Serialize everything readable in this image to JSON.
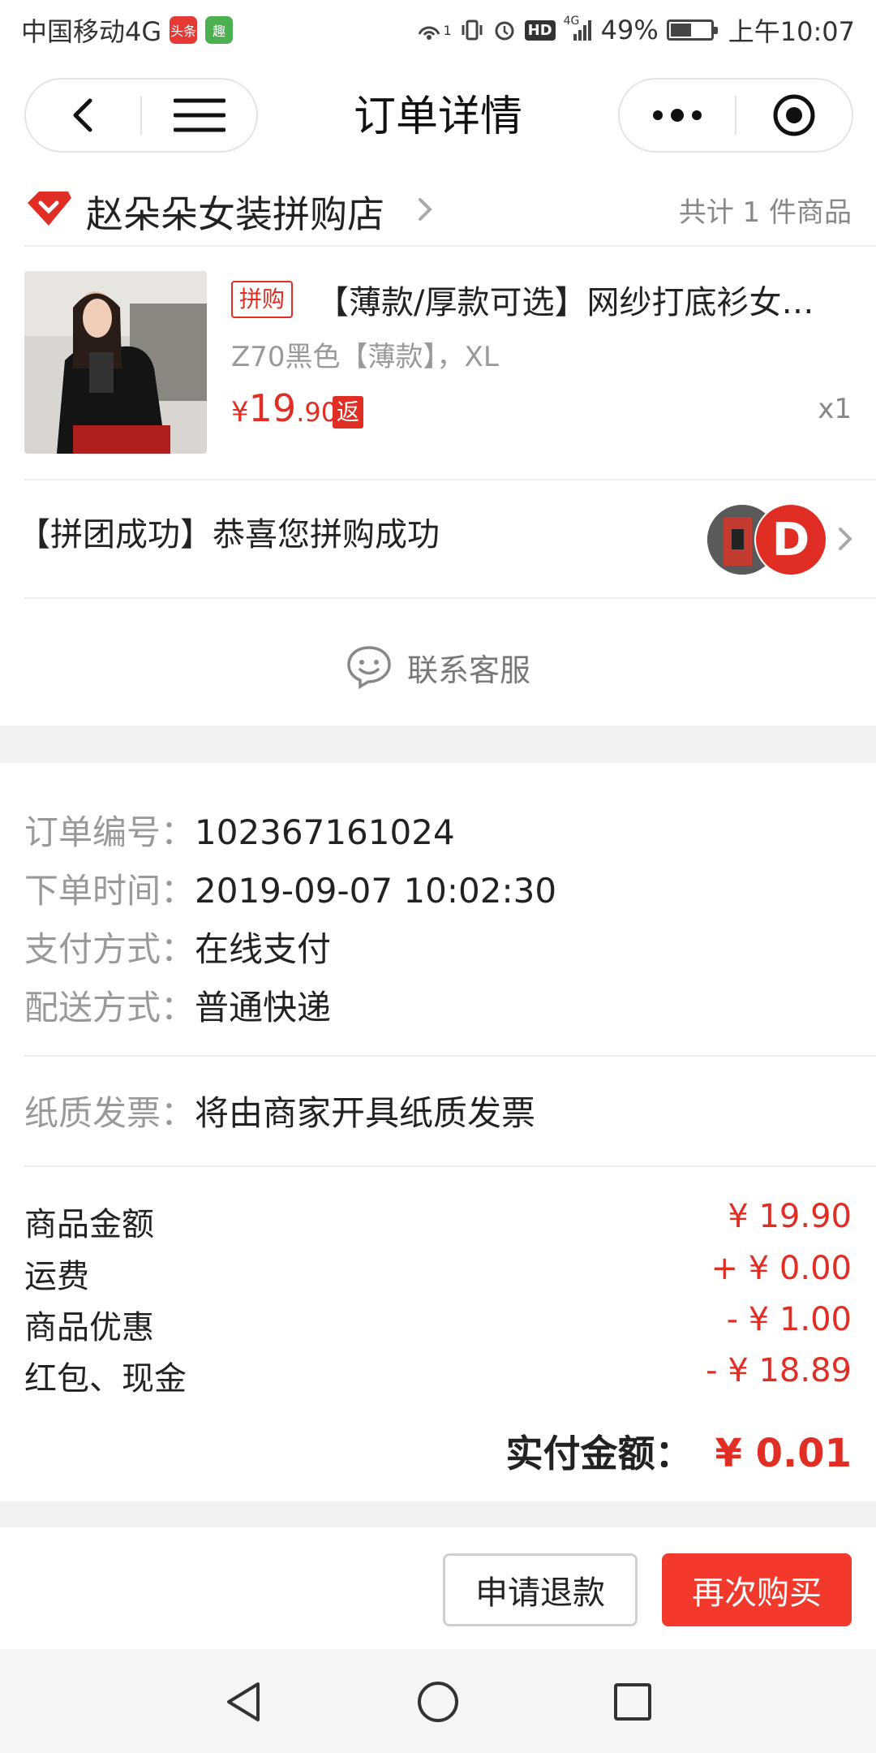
{
  "status_bar": {
    "carrier": "中国移动4G",
    "app_badge_1": "头条",
    "app_badge_2": "趣",
    "sim_sup": "1",
    "net_small": "4G",
    "hd": "HD",
    "battery": "49%",
    "battery_level": 0.49,
    "time": "上午10:07"
  },
  "title_bar": {
    "title": "订单详情",
    "icons": [
      "back-icon",
      "menu-icon",
      "more-icon",
      "target-icon"
    ]
  },
  "shop": {
    "name": "赵朵朵女装拼购店",
    "item_count": "共计 1 件商品"
  },
  "product": {
    "tag": "拼购",
    "title": "【薄款/厚款可选】网纱打底衫女…",
    "spec": "Z70黑色【薄款】，XL",
    "price_symbol": "¥",
    "price_int": "19",
    "price_dec": ".90",
    "rebate_tag": "返",
    "quantity": "x1"
  },
  "group": {
    "status": "【拼团成功】恭喜您拼购成功",
    "avatar_2_letter": "D"
  },
  "service": {
    "label": "联系客服"
  },
  "order_info": {
    "order_no_label": "订单编号：",
    "order_no": "102367161024",
    "time_label": "下单时间：",
    "time": "2019-09-07 10:02:30",
    "pay_label": "支付方式：",
    "pay": "在线支付",
    "ship_label": "配送方式：",
    "ship": "普通快递",
    "invoice_label": "纸质发票：",
    "invoice": "将由商家开具纸质发票"
  },
  "fees": {
    "goods_label": "商品金额",
    "goods_value": "¥ 19.90",
    "shipping_label": "运费",
    "shipping_value": "+ ¥ 0.00",
    "discount_label": "商品优惠",
    "discount_value": "- ¥ 1.00",
    "redpacket_label": "红包、现金",
    "redpacket_value": "- ¥ 18.89",
    "total_label": "实付金额：",
    "total_value": "¥ 0.01"
  },
  "actions": {
    "refund": "申请退款",
    "rebuy": "再次购买"
  },
  "colors": {
    "accent": "#e02e24",
    "button_red": "#f2392c"
  }
}
